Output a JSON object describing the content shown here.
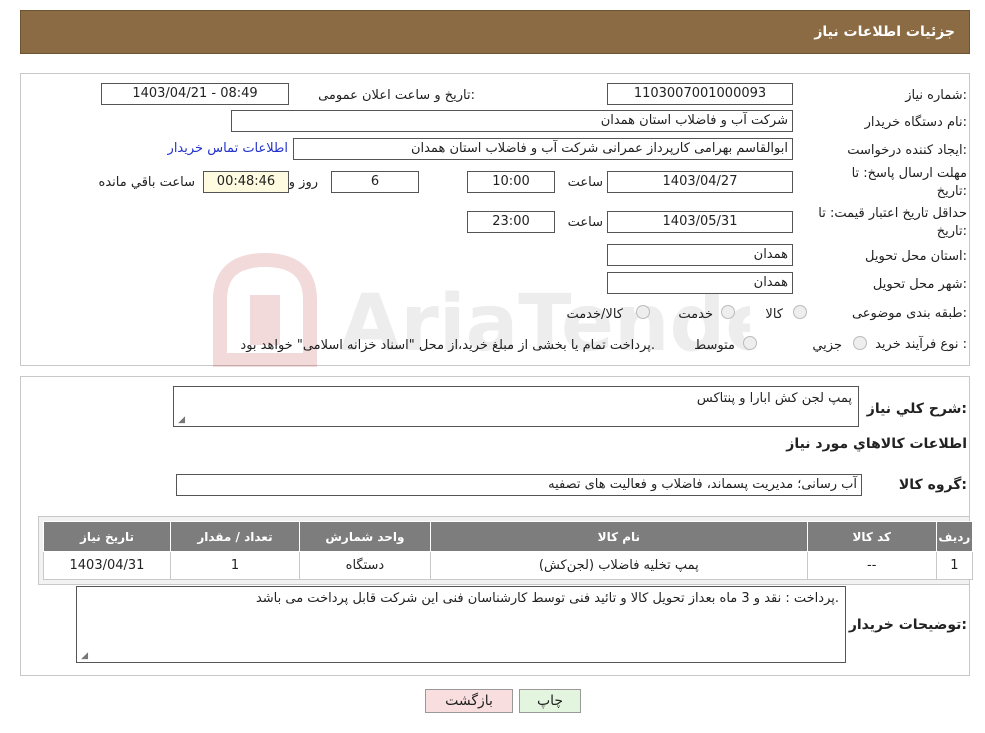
{
  "header": {
    "title": "جزئیات اطلاعات نیاز"
  },
  "watermark": {
    "text": "AriaTender.neT"
  },
  "fields": {
    "need_number_label": "شماره نیاز:",
    "need_number": "1103007001000093",
    "announce_label": "تاریخ و ساعت اعلان عمومی:",
    "announce_value": "1403/04/21 - 08:49",
    "buyer_label": "نام دستگاه خریدار:",
    "buyer_value": "شرکت آب و فاضلاب استان همدان",
    "creator_label": "ایجاد کننده درخواست:",
    "creator_value": "ابوالقاسم بهرامی کارپرداز عمرانی شرکت آب و فاضلاب استان همدان",
    "contact_link": "اطلاعات تماس خریدار",
    "reply_label_1": "مهلت ارسال پاسخ: تا",
    "reply_label_2": "تاریخ:",
    "reply_date": "1403/04/27",
    "time_label": "ساعت",
    "reply_time": "10:00",
    "days_value": "6",
    "days_label": "روز و",
    "remaining_time": "00:48:46",
    "remaining_label": "ساعت باقي مانده",
    "validity_label_1": "حداقل تاریخ اعتبار قیمت: تا",
    "validity_label_2": "تاریخ:",
    "validity_date": "1403/05/31",
    "validity_time": "23:00",
    "province_label": "استان محل تحویل:",
    "province_value": "همدان",
    "city_label": "شهر محل تحویل:",
    "city_value": "همدان",
    "category_label": "طبقه بندی موضوعی:",
    "category_options": [
      "کالا",
      "خدمت",
      "کالا/خدمت"
    ],
    "process_label": "نوع فرآیند خرید :",
    "process_options": [
      "جزیي",
      "متوسط"
    ],
    "process_note": "پرداخت تمام یا بخشی از مبلغ خرید،از محل \"اسناد خزانه اسلامی\" خواهد بود."
  },
  "description": {
    "label": "شرح کلي نیاز:",
    "value": "پمپ لجن کش ابارا و پنتاکس"
  },
  "goods_info_title": "اطلاعات کالاهاي مورد نیاز",
  "goods_group": {
    "label": "گروه کالا:",
    "value": "آب رسانی؛ مدیریت پسماند، فاضلاب و فعالیت های تصفیه"
  },
  "table": {
    "headers": [
      "ردیف",
      "کد کالا",
      "نام کالا",
      "واحد شمارش",
      "تعداد / مقدار",
      "تاریخ نیاز"
    ],
    "rows": [
      [
        "1",
        "--",
        "پمپ تخلیه فاضلاب (لجن‌کش)",
        "دستگاه",
        "1",
        "1403/04/31"
      ]
    ]
  },
  "buyer_notes": {
    "label": "توضیحات خریدار:",
    "value": "پرداخت : نقد و 3 ماه بعداز تحویل کالا و تائید فنی توسط کارشناسان فنی این شرکت  قابل پرداخت می باشد."
  },
  "buttons": {
    "print": "چاپ",
    "back": "بازگشت"
  },
  "colors": {
    "header_bg": "#8b6b43",
    "table_header_bg": "#7d7d7d",
    "back_button_bg": "#f8dede",
    "print_button_bg": "#e4f5df",
    "link": "#2233cc"
  }
}
